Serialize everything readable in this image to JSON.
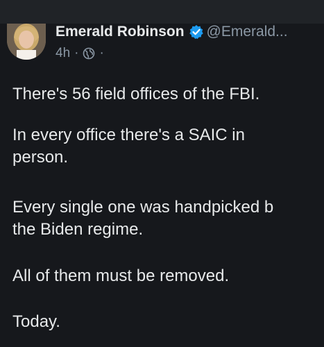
{
  "post": {
    "author_name": "Emerald Robinson",
    "handle": "@Emerald...",
    "timestamp": "4h",
    "separator": "·",
    "separator_end": "·",
    "verified_icon": "verified-badge-icon",
    "visibility_icon": "globe-icon",
    "paragraphs": [
      "There's 56 field offices of the FBI.",
      "In every office there's a SAIC in\nperson.",
      "Every single one was handpicked b\nthe Biden regime.",
      "All of them must be removed.",
      "Today."
    ]
  },
  "colors": {
    "background": "#16181c",
    "top_bar": "#202327",
    "text": "#e7e9ea",
    "secondary_text": "#8b98a5",
    "verified_blue": "#1d9bf0"
  }
}
